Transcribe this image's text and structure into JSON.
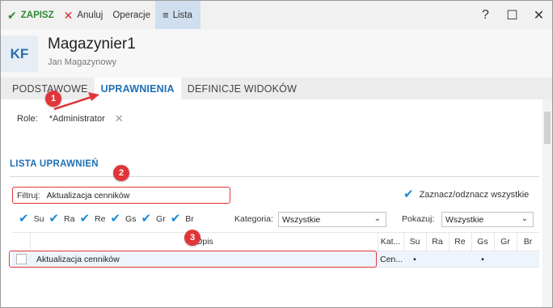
{
  "toolbar": {
    "save_label": "ZAPISZ",
    "cancel_label": "Anuluj",
    "operations_label": "Operacje",
    "list_label": "Lista",
    "help_glyph": "?",
    "maximize_glyph": "☐",
    "close_glyph": "✕"
  },
  "header": {
    "avatar_initials": "KF",
    "title": "Magazynier1",
    "subtitle": "Jan Magazynowy"
  },
  "tabs": [
    {
      "label": "PODSTAWOWE",
      "active": false
    },
    {
      "label": "UPRAWNIENIA",
      "active": true
    },
    {
      "label": "DEFINICJE WIDOKÓW",
      "active": false
    }
  ],
  "roles": {
    "label": "Role:",
    "value": "*Administrator",
    "remove_glyph": "✕"
  },
  "permissions": {
    "section_title": "LISTA UPRAWNIEŃ",
    "filter_label": "Filtruj:",
    "filter_value": "Aktualizacja cenników",
    "toggle_all_label": "Zaznacz/odznacz wszystkie",
    "chips": [
      {
        "label": "Su",
        "checked": true
      },
      {
        "label": "Ra",
        "checked": true
      },
      {
        "label": "Re",
        "checked": true
      },
      {
        "label": "Gs",
        "checked": true
      },
      {
        "label": "Gr",
        "checked": true
      },
      {
        "label": "Br",
        "checked": true
      }
    ],
    "category_label": "Kategoria:",
    "category_value": "Wszystkie",
    "show_label": "Pokazuj:",
    "show_value": "Wszystkie",
    "columns": {
      "opis": "Opis",
      "kat": "Kat...",
      "su": "Su",
      "ra": "Ra",
      "re": "Re",
      "gs": "Gs",
      "gr": "Gr",
      "br": "Br"
    },
    "rows": [
      {
        "name": "Aktualizacja cenników",
        "kat": "Cen...",
        "su": "•",
        "ra": "",
        "re": "",
        "gs": "•",
        "gr": "",
        "br": ""
      }
    ]
  },
  "annotations": [
    "1",
    "2",
    "3"
  ],
  "colors": {
    "accent": "#1e6fb5",
    "save_green": "#2f8a2f",
    "cancel_red": "#d9262b",
    "annotation_red": "#e0363a",
    "check_blue": "#1c8ad6"
  }
}
